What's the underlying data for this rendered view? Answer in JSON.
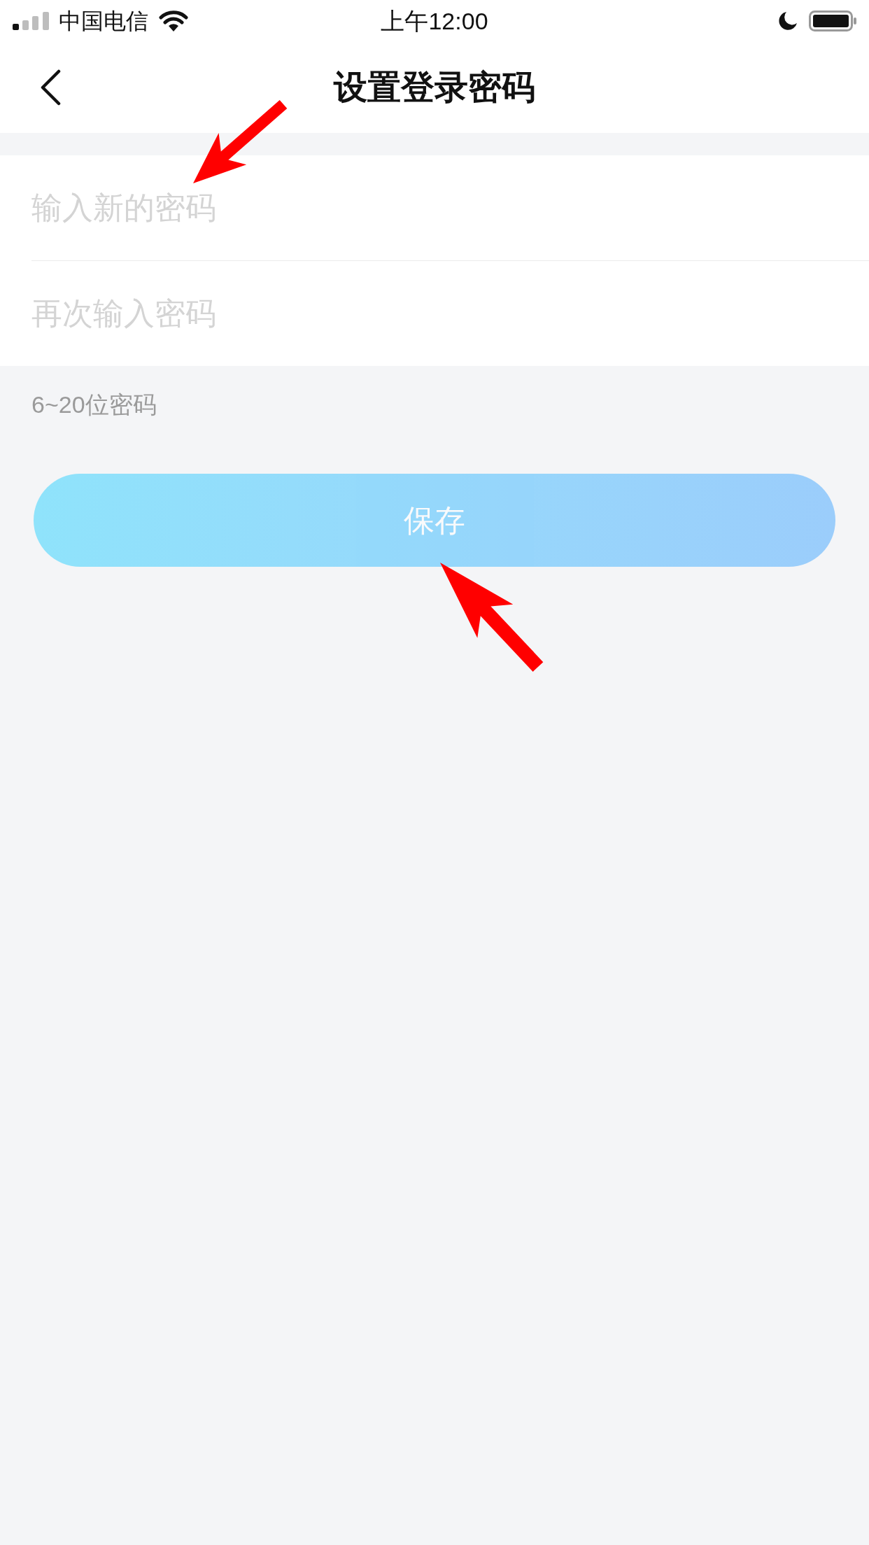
{
  "status_bar": {
    "carrier": "中国电信",
    "time": "上午12:00"
  },
  "nav_bar": {
    "title": "设置登录密码"
  },
  "password_fields": [
    {
      "placeholder": "输入新的密码"
    },
    {
      "placeholder": "再次输入密码"
    }
  ],
  "hint": "6~20位密码",
  "save_button": {
    "label": "保存",
    "disabled": true
  }
}
